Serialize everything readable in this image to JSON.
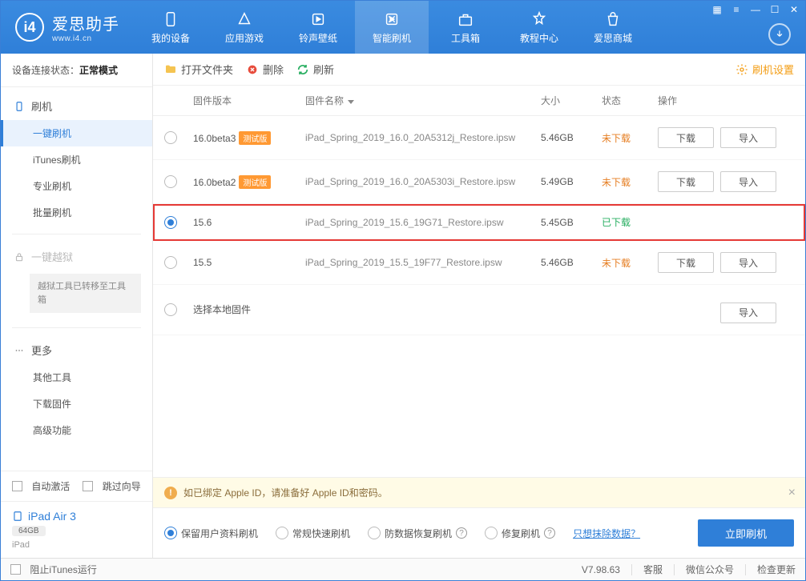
{
  "brand": {
    "name": "爱思助手",
    "url": "www.i4.cn"
  },
  "topnav": [
    {
      "label": "我的设备"
    },
    {
      "label": "应用游戏"
    },
    {
      "label": "铃声壁纸"
    },
    {
      "label": "智能刷机"
    },
    {
      "label": "工具箱"
    },
    {
      "label": "教程中心"
    },
    {
      "label": "爱思商城"
    }
  ],
  "sidebar": {
    "status_label": "设备连接状态：",
    "status_value": "正常模式",
    "group_flash": "刷机",
    "items_flash": [
      "一键刷机",
      "iTunes刷机",
      "专业刷机",
      "批量刷机"
    ],
    "group_jailbreak": "一键越狱",
    "jailbreak_note": "越狱工具已转移至工具箱",
    "group_more": "更多",
    "items_more": [
      "其他工具",
      "下载固件",
      "高级功能"
    ],
    "auto_activate": "自动激活",
    "skip_guide": "跳过向导",
    "device_name": "iPad Air 3",
    "device_storage": "64GB",
    "device_type": "iPad"
  },
  "toolbar": {
    "open_folder": "打开文件夹",
    "delete": "删除",
    "refresh": "刷新",
    "settings": "刷机设置"
  },
  "columns": {
    "version": "固件版本",
    "name": "固件名称",
    "size": "大小",
    "status": "状态",
    "ops": "操作"
  },
  "status_text": {
    "pending": "未下载",
    "done": "已下载"
  },
  "ops_text": {
    "download": "下载",
    "import": "导入"
  },
  "beta_tag": "测试版",
  "firmware": [
    {
      "version": "16.0beta3",
      "beta": true,
      "name": "iPad_Spring_2019_16.0_20A5312j_Restore.ipsw",
      "size": "5.46GB",
      "status": "pending",
      "selected": false
    },
    {
      "version": "16.0beta2",
      "beta": true,
      "name": "iPad_Spring_2019_16.0_20A5303i_Restore.ipsw",
      "size": "5.49GB",
      "status": "pending",
      "selected": false
    },
    {
      "version": "15.6",
      "beta": false,
      "name": "iPad_Spring_2019_15.6_19G71_Restore.ipsw",
      "size": "5.45GB",
      "status": "done",
      "selected": true
    },
    {
      "version": "15.5",
      "beta": false,
      "name": "iPad_Spring_2019_15.5_19F77_Restore.ipsw",
      "size": "5.46GB",
      "status": "pending",
      "selected": false
    }
  ],
  "local_row": "选择本地固件",
  "warn": "如已绑定 Apple ID，请准备好 Apple ID和密码。",
  "flash_options": [
    {
      "label": "保留用户资料刷机",
      "on": true,
      "help": false
    },
    {
      "label": "常规快速刷机",
      "on": false,
      "help": false
    },
    {
      "label": "防数据恢复刷机",
      "on": false,
      "help": true
    },
    {
      "label": "修复刷机",
      "on": false,
      "help": true
    }
  ],
  "erase_link": "只想抹除数据？",
  "flash_button": "立即刷机",
  "footer": {
    "block_itunes": "阻止iTunes运行",
    "version": "V7.98.63",
    "service": "客服",
    "wechat": "微信公众号",
    "update": "检查更新"
  }
}
